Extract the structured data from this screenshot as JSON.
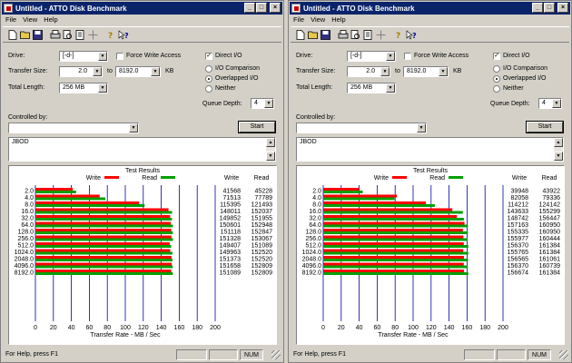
{
  "window": {
    "title": "Untitled - ATTO Disk Benchmark",
    "minimize": "_",
    "maximize": "□",
    "close": "×"
  },
  "menu": {
    "file": "File",
    "view": "View",
    "help": "Help"
  },
  "toolbar_icons": [
    "new-icon",
    "open-icon",
    "save-icon",
    "print-icon",
    "print-preview-icon",
    "properties-icon",
    "move-icon",
    "help-icon",
    "context-help-icon"
  ],
  "labels": {
    "drive": "Drive:",
    "transfer_size": "Transfer Size:",
    "to": "to",
    "kb": "KB",
    "total_length": "Total Length:",
    "force_write_access": "Force Write Access",
    "direct_io": "Direct I/O",
    "io_comparison": "I/O Comparison",
    "overlapped_io": "Overlapped I/O",
    "neither": "Neither",
    "queue_depth": "Queue Depth:",
    "controlled_by": "Controlled by:",
    "start": "Start",
    "test_results": "Test Results",
    "write": "Write",
    "read": "Read",
    "col_write": "Write",
    "col_read": "Read",
    "xaxis": "Transfer Rate - MB / Sec"
  },
  "status": {
    "help_text": "For Help, press F1",
    "num": "NUM"
  },
  "colors": {
    "write": "#ff0000",
    "read": "#00a000",
    "grid": "#0000a0"
  },
  "panels": [
    {
      "drive": "[-d-]",
      "transfer_from": "2.0",
      "transfer_to": "8192.0",
      "total_length": "256 MB",
      "force_write_access": false,
      "direct_io": true,
      "io_mode": "overlapped",
      "queue_depth": "4",
      "controlled_by": "",
      "description": "JBOD"
    },
    {
      "drive": "[-d-]",
      "transfer_from": "2.0",
      "transfer_to": "8192.0",
      "total_length": "256 MB",
      "force_write_access": false,
      "direct_io": true,
      "io_mode": "overlapped",
      "queue_depth": "4",
      "controlled_by": "",
      "description": "JBOD"
    }
  ],
  "chart_data": [
    {
      "type": "bar",
      "title": "Test Results",
      "xlabel": "Transfer Rate - MB / Sec",
      "xlim": [
        0,
        200
      ],
      "xticks": [
        "0",
        "20",
        "40",
        "60",
        "80",
        "100",
        "120",
        "140",
        "160",
        "180",
        "200"
      ],
      "categories": [
        "2.0",
        "4.0",
        "8.0",
        "16.0",
        "32.0",
        "64.0",
        "128.0",
        "256.0",
        "512.0",
        "1024.0",
        "2048.0",
        "4096.0",
        "8192.0"
      ],
      "series": [
        {
          "name": "Write",
          "color": "#ff0000",
          "values": [
            41568,
            71513,
            115395,
            148011,
            149852,
            150601,
            151118,
            151328,
            149407,
            149963,
            151373,
            151658,
            151089
          ]
        },
        {
          "name": "Read",
          "color": "#00a000",
          "values": [
            45228,
            77789,
            121493,
            152037,
            151955,
            152948,
            152847,
            153067,
            151089,
            152520,
            152520,
            152809,
            152809
          ]
        }
      ]
    },
    {
      "type": "bar",
      "title": "Test Results",
      "xlabel": "Transfer Rate - MB / Sec",
      "xlim": [
        0,
        200
      ],
      "xticks": [
        "0",
        "20",
        "40",
        "60",
        "80",
        "100",
        "120",
        "140",
        "160",
        "180",
        "200"
      ],
      "categories": [
        "2.0",
        "4.0",
        "8.0",
        "16.0",
        "32.0",
        "64.0",
        "128.0",
        "256.0",
        "512.0",
        "1024.0",
        "2048.0",
        "4096.0",
        "8192.0"
      ],
      "series": [
        {
          "name": "Write",
          "color": "#ff0000",
          "values": [
            39948,
            82058,
            114212,
            143633,
            148742,
            157163,
            155335,
            155977,
            156370,
            155765,
            156565,
            156370,
            156674
          ]
        },
        {
          "name": "Read",
          "color": "#00a000",
          "values": [
            43922,
            79336,
            124142,
            155299,
            156447,
            160950,
            160950,
            160444,
            161384,
            161384,
            161061,
            160739,
            161384
          ]
        }
      ]
    }
  ]
}
